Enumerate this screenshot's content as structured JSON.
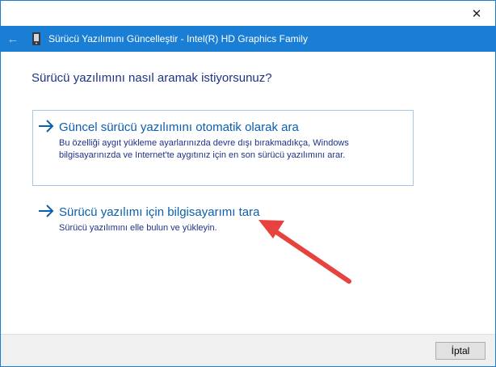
{
  "window": {
    "close_glyph": "✕",
    "back_glyph": "←",
    "title": "Sürücü Yazılımını Güncelleştir - Intel(R) HD Graphics Family",
    "accent_color": "#1a7fd4"
  },
  "main": {
    "question": "Sürücü yazılımını nasıl aramak istiyorsunuz?",
    "options": [
      {
        "title": "Güncel sürücü yazılımını otomatik olarak ara",
        "description": "Bu özelliği aygıt yükleme ayarlarınızda devre dışı bırakmadıkça, Windows bilgisayarınızda ve Internet'te aygıtınız için en son sürücü yazılımını arar.",
        "icon": "right-arrow-icon"
      },
      {
        "title": "Sürücü yazılımı için bilgisayarımı tara",
        "description": "Sürücü yazılımını elle bulun ve yükleyin.",
        "icon": "right-arrow-icon"
      }
    ]
  },
  "footer": {
    "cancel_label": "İptal"
  },
  "annotation": {
    "color": "#e8423f",
    "icon": "red-pointer-arrow"
  }
}
